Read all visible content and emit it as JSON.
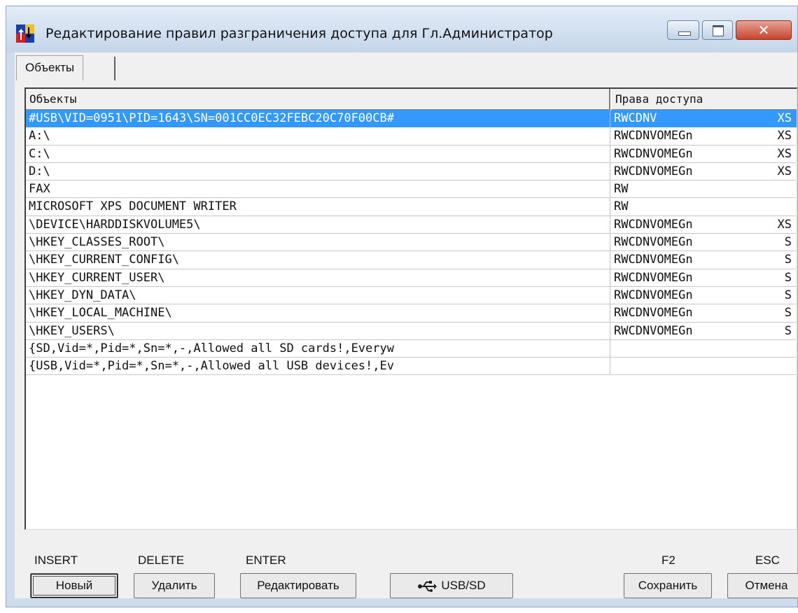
{
  "window": {
    "title": "Редактирование правил разграничения доступа для Гл.Администратор",
    "close_glyph": "✕"
  },
  "tabs": [
    {
      "label": "Объекты"
    }
  ],
  "columns": {
    "object": "Объекты",
    "rights": "Права доступа"
  },
  "rows": [
    {
      "object": "#USB\\VID=0951\\PID=1643\\SN=001CC0EC32FEBC20C70F00CB#",
      "rights": "RWCDNV",
      "flags": "XS",
      "selected": true
    },
    {
      "object": "A:\\",
      "rights": "RWCDNVOMEGn",
      "flags": "XS"
    },
    {
      "object": "C:\\",
      "rights": "RWCDNVOMEGn",
      "flags": "XS"
    },
    {
      "object": "D:\\",
      "rights": "RWCDNVOMEGn",
      "flags": "XS"
    },
    {
      "object": "FAX",
      "rights": "RW",
      "flags": ""
    },
    {
      "object": "MICROSOFT XPS DOCUMENT WRITER",
      "rights": "RW",
      "flags": ""
    },
    {
      "object": "\\DEVICE\\HARDDISKVOLUME5\\",
      "rights": "RWCDNVOMEGn",
      "flags": "XS"
    },
    {
      "object": "\\HKEY_CLASSES_ROOT\\",
      "rights": "RWCDNVOMEGn",
      "flags": "S"
    },
    {
      "object": "\\HKEY_CURRENT_CONFIG\\",
      "rights": "RWCDNVOMEGn",
      "flags": "S"
    },
    {
      "object": "\\HKEY_CURRENT_USER\\",
      "rights": "RWCDNVOMEGn",
      "flags": "S"
    },
    {
      "object": "\\HKEY_DYN_DATA\\",
      "rights": "RWCDNVOMEGn",
      "flags": "S"
    },
    {
      "object": "\\HKEY_LOCAL_MACHINE\\",
      "rights": "RWCDNVOMEGn",
      "flags": "S"
    },
    {
      "object": "\\HKEY_USERS\\",
      "rights": "RWCDNVOMEGn",
      "flags": "S"
    },
    {
      "object": "{SD,Vid=*,Pid=*,Sn=*,-,Allowed all SD cards!,Everyw",
      "rights": "",
      "flags": ""
    },
    {
      "object": "{USB,Vid=*,Pid=*,Sn=*,-,Allowed all USB devices!,Ev",
      "rights": "",
      "flags": ""
    }
  ],
  "hotkeys": {
    "insert": "INSERT",
    "delete": "DELETE",
    "enter": "ENTER",
    "save": "F2",
    "cancel": "ESC"
  },
  "buttons": {
    "new": "Новый",
    "delete": "Удалить",
    "edit": "Редактировать",
    "usb_sd": "USB/SD",
    "save": "Сохранить",
    "cancel": "Отмена"
  },
  "colors": {
    "selection": "#3399ff",
    "window_frame": "#cfdcec",
    "close_button": "#c6442e"
  },
  "icons": {
    "app": "shield-app-icon",
    "usb": "usb-icon"
  }
}
